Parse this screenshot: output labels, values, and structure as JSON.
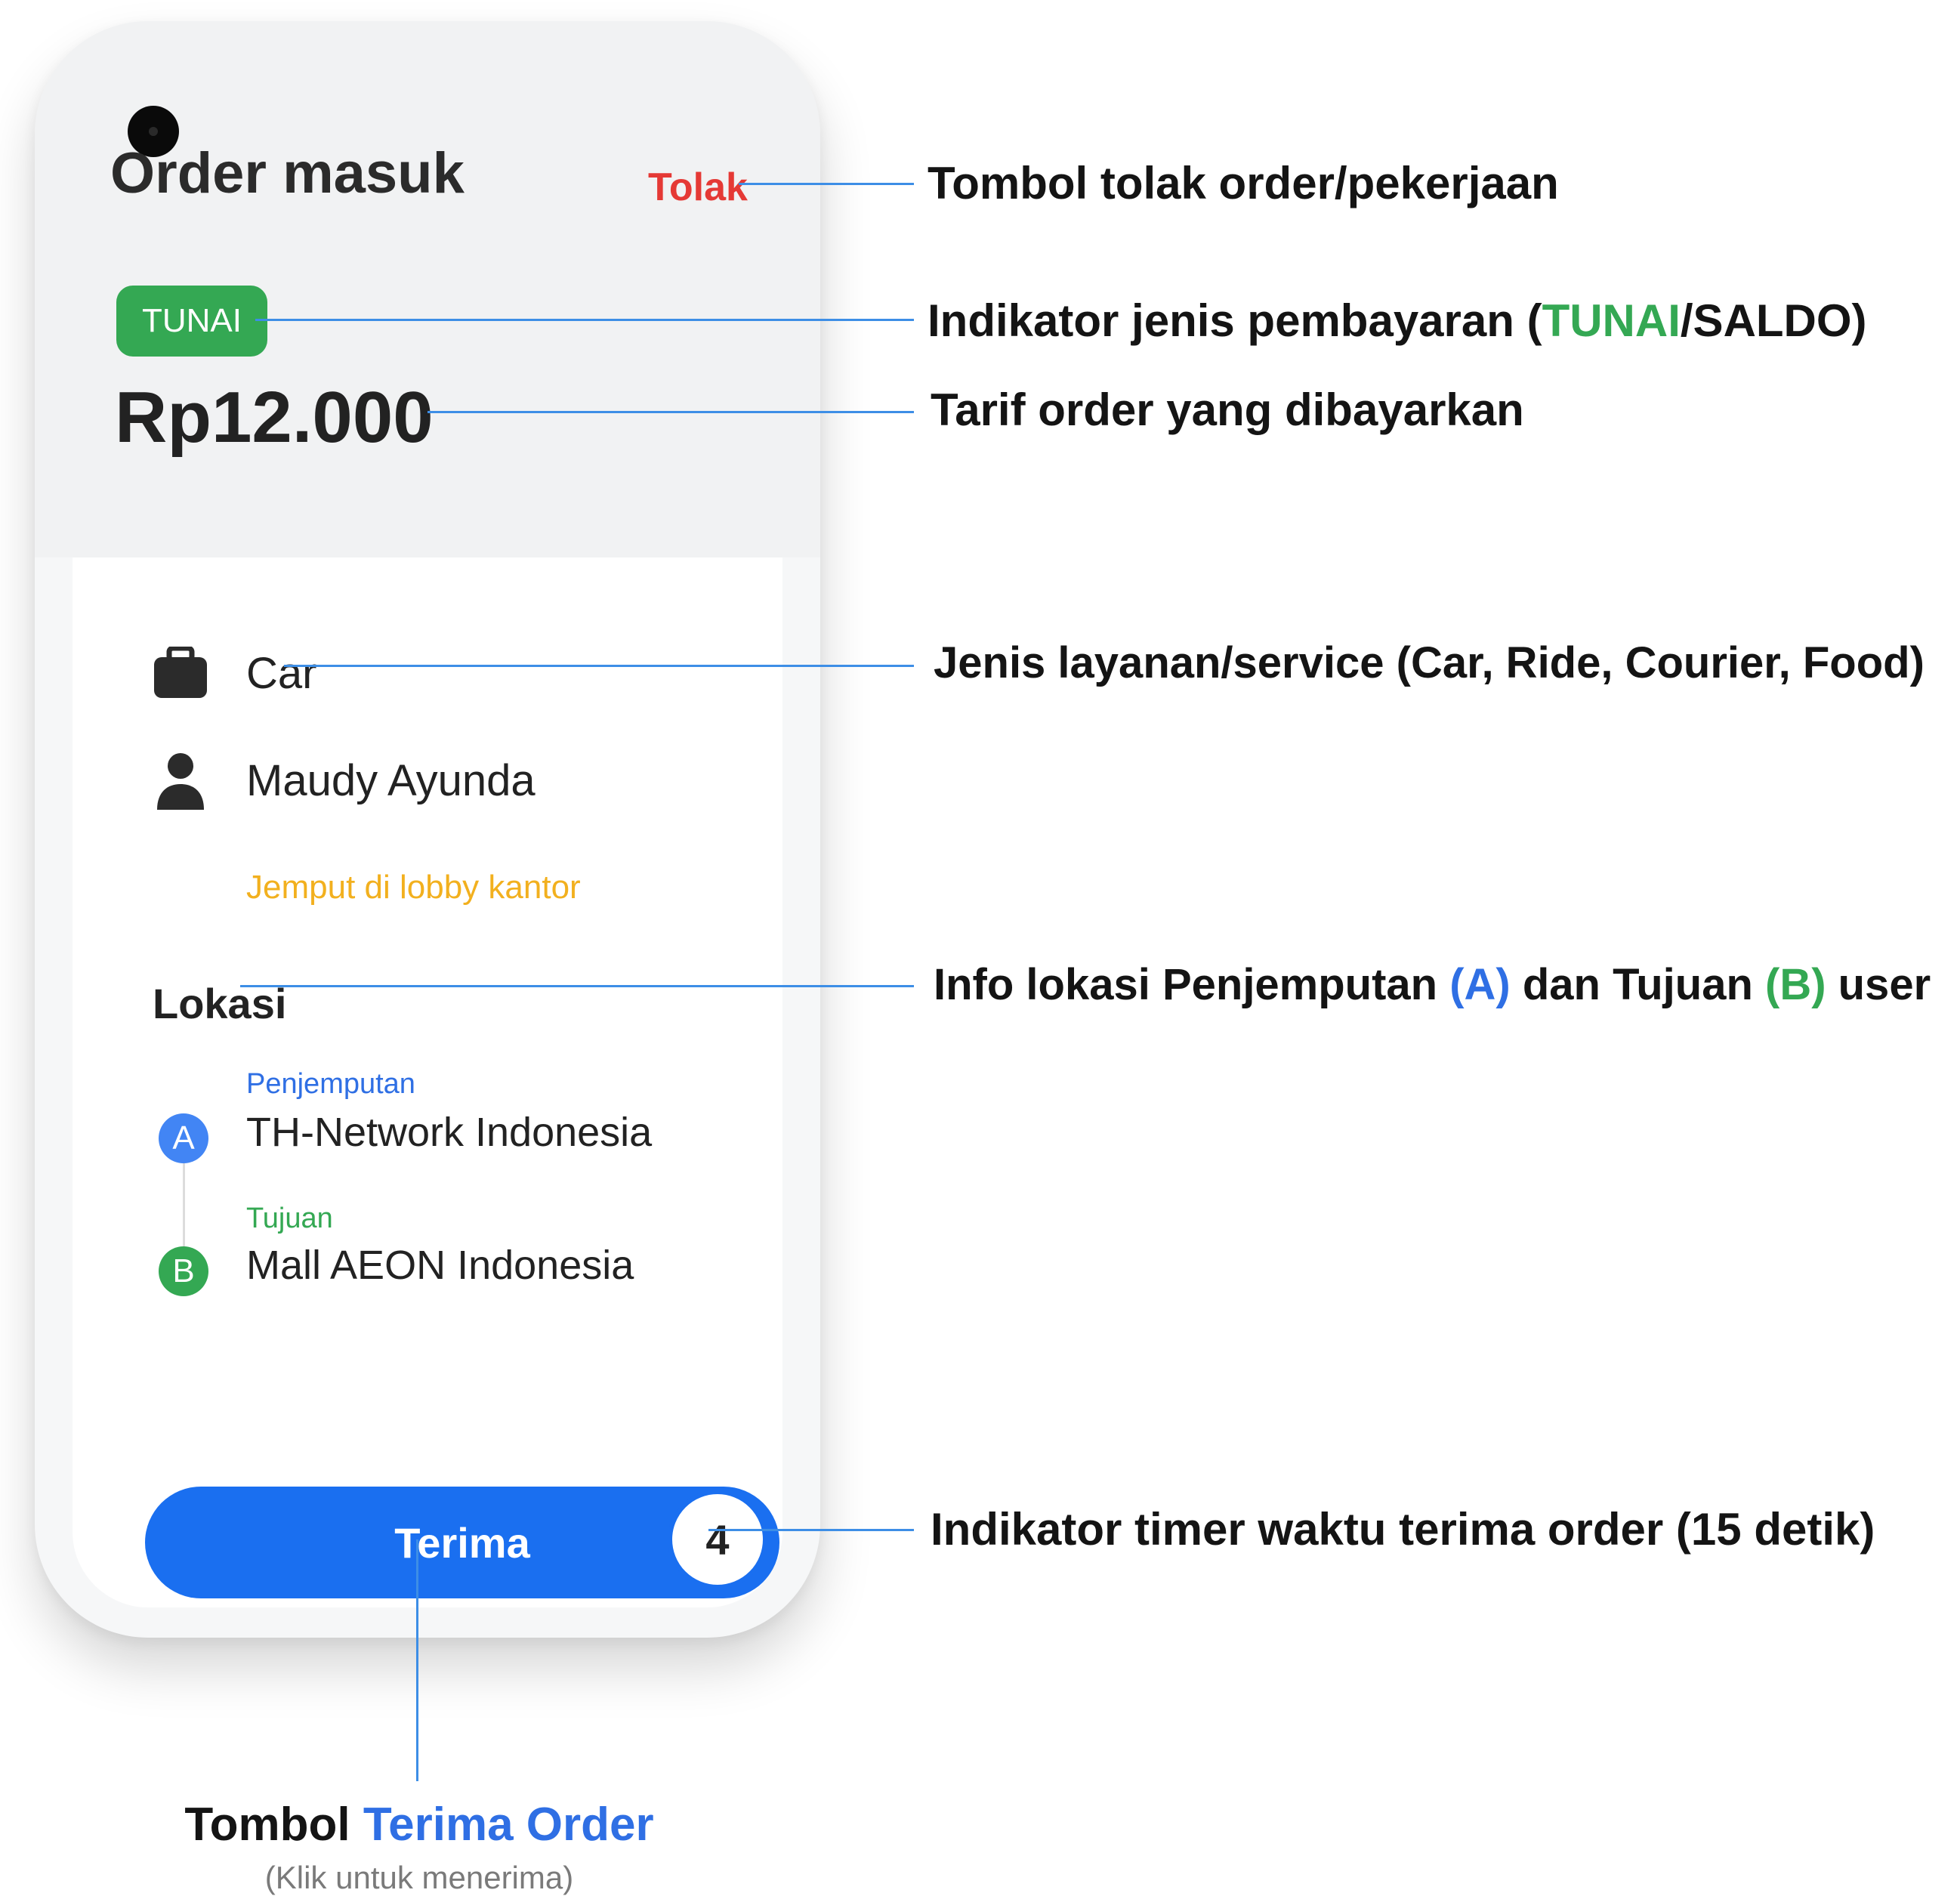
{
  "order": {
    "title": "Order masuk",
    "reject_label": "Tolak",
    "payment_type": "TUNAI",
    "price": "Rp12.000",
    "service": "Car",
    "user_name": "Maudy Ayunda",
    "pickup_note": "Jemput di lobby kantor",
    "location_heading": "Lokasi",
    "pickup": {
      "marker": "A",
      "label": "Penjemputan",
      "place": "TH-Network Indonesia"
    },
    "destination": {
      "marker": "B",
      "label": "Tujuan",
      "place": "Mall AEON Indonesia"
    },
    "accept_label": "Terima",
    "timer_value": "4"
  },
  "annotations": {
    "reject": "Tombol tolak order/pekerjaan",
    "payment_prefix": "Indikator jenis pembayaran (",
    "payment_tunai": "TUNAI",
    "payment_suffix": "/SALDO)",
    "tariff": "Tarif order yang dibayarkan",
    "service": "Jenis layanan/service (Car, Ride, Courier, Food)",
    "location_prefix": "Info lokasi Penjemputan ",
    "location_a": "(A)",
    "location_mid": " dan Tujuan ",
    "location_b": "(B)",
    "location_suffix": " user",
    "timer": "Indikator timer waktu terima order (15 detik)",
    "accept_prefix": "Tombol ",
    "accept_highlight": "Terima Order",
    "accept_sub": "(Klik untuk menerima)"
  },
  "colors": {
    "accent_blue": "#1a6ff0",
    "reject_red": "#e53935",
    "cash_green": "#34a853",
    "note_yellow": "#f2b01e"
  },
  "icons": {
    "service": "briefcase-icon",
    "user": "person-icon"
  }
}
